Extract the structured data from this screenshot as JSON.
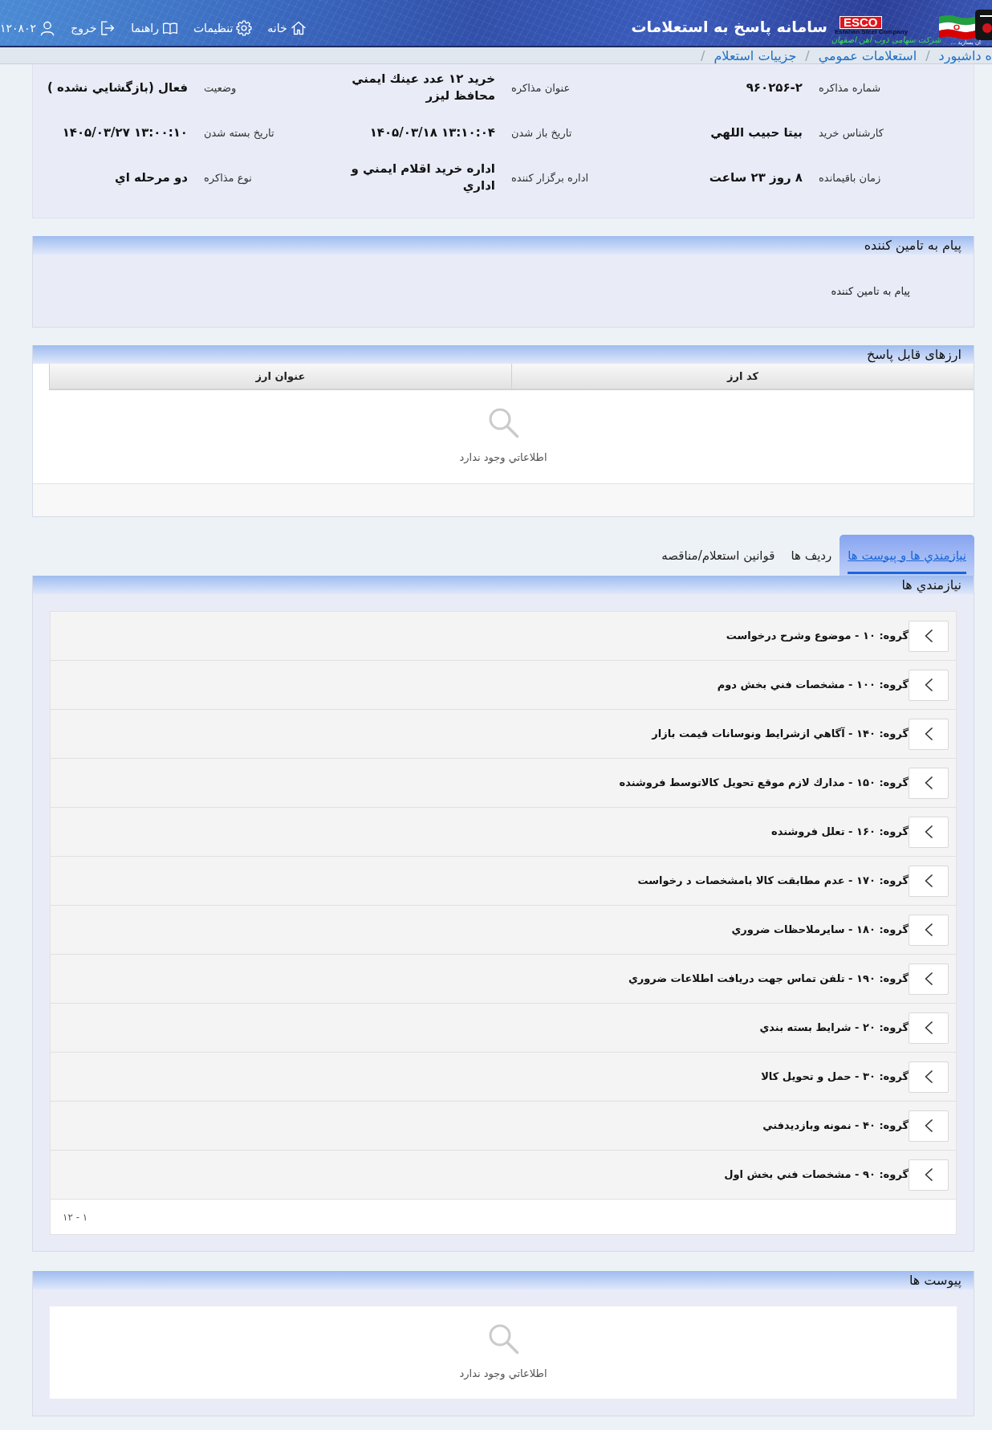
{
  "header": {
    "title": "سامانه پاسخ به استعلامات",
    "logo": {
      "text": "ESCO",
      "subtitle": "Esfahan Steel Company"
    },
    "company_name": "شرکت سهامی ذوب آهن اصفهان",
    "slogan": "ان بسازید ...",
    "nav": [
      {
        "kind": "home",
        "label": "خانه"
      },
      {
        "kind": "settings",
        "label": "تنظيمات"
      },
      {
        "kind": "help",
        "label": "راهنما"
      },
      {
        "kind": "logout",
        "label": "خروج"
      },
      {
        "kind": "user",
        "label": "۱۲۰۸۰۲"
      }
    ]
  },
  "breadcrumb": {
    "separator": "/",
    "items": [
      "ه داشبورد",
      "استعلامات عمومي",
      "جزييات استعلام"
    ]
  },
  "details": [
    {
      "label": "شماره مذاکره",
      "value": "۹۶۰۲۵۶-۲"
    },
    {
      "label": "عنوان مذاکره",
      "value": "خريد ۱۲ عدد عينك ايمني محافظ ليزر"
    },
    {
      "label": "وضعيت",
      "value": "فعال (بازگشايي نشده )"
    },
    {
      "label": "کارشناس خريد",
      "value": "بيتا حبيب اللهي"
    },
    {
      "label": "تاريخ باز شدن",
      "value": "۱۴۰۵/۰۳/۱۸ ۱۳:۱۰:۰۴"
    },
    {
      "label": "تاريخ بسته شدن",
      "value": "۱۴۰۵/۰۳/۲۷ ۱۳:۰۰:۱۰"
    },
    {
      "label": "زمان باقيمانده",
      "value": "۸ روز ۲۳ ساعت"
    },
    {
      "label": "اداره برگزار کننده",
      "value": "اداره خريد اقلام ايمني و اداري"
    },
    {
      "label": "نوع مذاکره",
      "value": "دو مرحله اي"
    }
  ],
  "supplier_message": {
    "title": "پيام به تامين كننده",
    "text": "پيام به تامين كننده"
  },
  "currencies": {
    "title": "ارزهای قابل پاسخ",
    "columns": [
      "كد ارز",
      "عنوان ارز"
    ],
    "empty_text": "اطلاعاتي وجود ندارد"
  },
  "tabs": [
    {
      "label": "نيازمندي ها و پيوست ها",
      "selected": true
    },
    {
      "label": "رديف ها",
      "selected": false
    },
    {
      "label": "قوانين استعلام/مناقصه",
      "selected": false
    }
  ],
  "requirements": {
    "title": "نيازمندي ها",
    "groups": [
      {
        "label": "گروه: ۱۰ - موضوع وشرح درخواست",
        "expanded": false
      },
      {
        "label": "گروه: ۱۰۰ - مشخصات فني بخش دوم",
        "expanded": false
      },
      {
        "label": "گروه: ۱۴۰ - آگاهي ازشرايط ونوسانات قيمت بازار",
        "expanded": false
      },
      {
        "label": "گروه: ۱۵۰ - مدارك لازم موقع تحويل كالاتوسط فروشنده",
        "expanded": false
      },
      {
        "label": "گروه: ۱۶۰ - تعلل فروشنده",
        "expanded": false
      },
      {
        "label": "گروه: ۱۷۰ - عدم مطابقت كالا بامشخصات د رخواست",
        "expanded": false
      },
      {
        "label": "گروه: ۱۸۰ - سايرملاحظات ضروري",
        "expanded": false
      },
      {
        "label": "گروه: ۱۹۰ - تلفن تماس جهت دريافت اطلاعات ضروري",
        "expanded": false
      },
      {
        "label": "گروه: ۲۰ - شرايط بسته بندي",
        "expanded": false
      },
      {
        "label": "گروه: ۳۰ - حمل و تحويل كالا",
        "expanded": false
      },
      {
        "label": "گروه: ۴۰ - نمونه وبازديدفني",
        "expanded": false
      },
      {
        "label": "گروه: ۹۰ - مشخصات فني بخش اول",
        "expanded": false
      }
    ],
    "pager": "۱ - ۱۲"
  },
  "attachments": {
    "title": "پيوست ها",
    "empty_text": "اطلاعاتي وجود ندارد"
  }
}
